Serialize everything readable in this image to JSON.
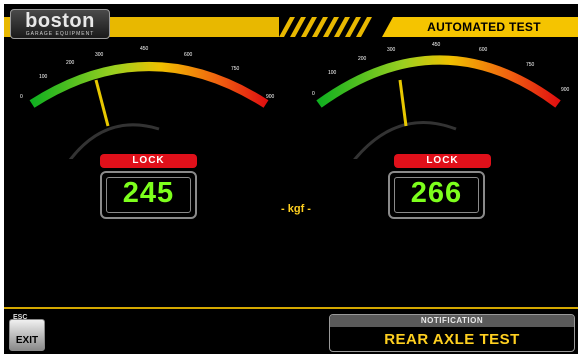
{
  "brand": {
    "name": "boston",
    "tagline": "GARAGE EQUIPMENT"
  },
  "header": {
    "title": "AUTOMATED TEST"
  },
  "gauge_scale": {
    "min": 0,
    "max": 900,
    "ticks": [
      "0",
      "100",
      "200",
      "300",
      "450",
      "600",
      "750",
      "900"
    ]
  },
  "gauges": [
    {
      "lock_label": "LOCK",
      "value": "245"
    },
    {
      "lock_label": "LOCK",
      "value": "266"
    }
  ],
  "unit_label": "- kgf -",
  "footer": {
    "esc_label": "ESC",
    "exit_label": "EXIT",
    "notification_header": "NOTIFICATION",
    "notification_text": "REAR AXLE TEST"
  },
  "colors": {
    "accent": "#ffd020",
    "value_green": "#7dff1c",
    "lock_red": "#e0101a"
  }
}
